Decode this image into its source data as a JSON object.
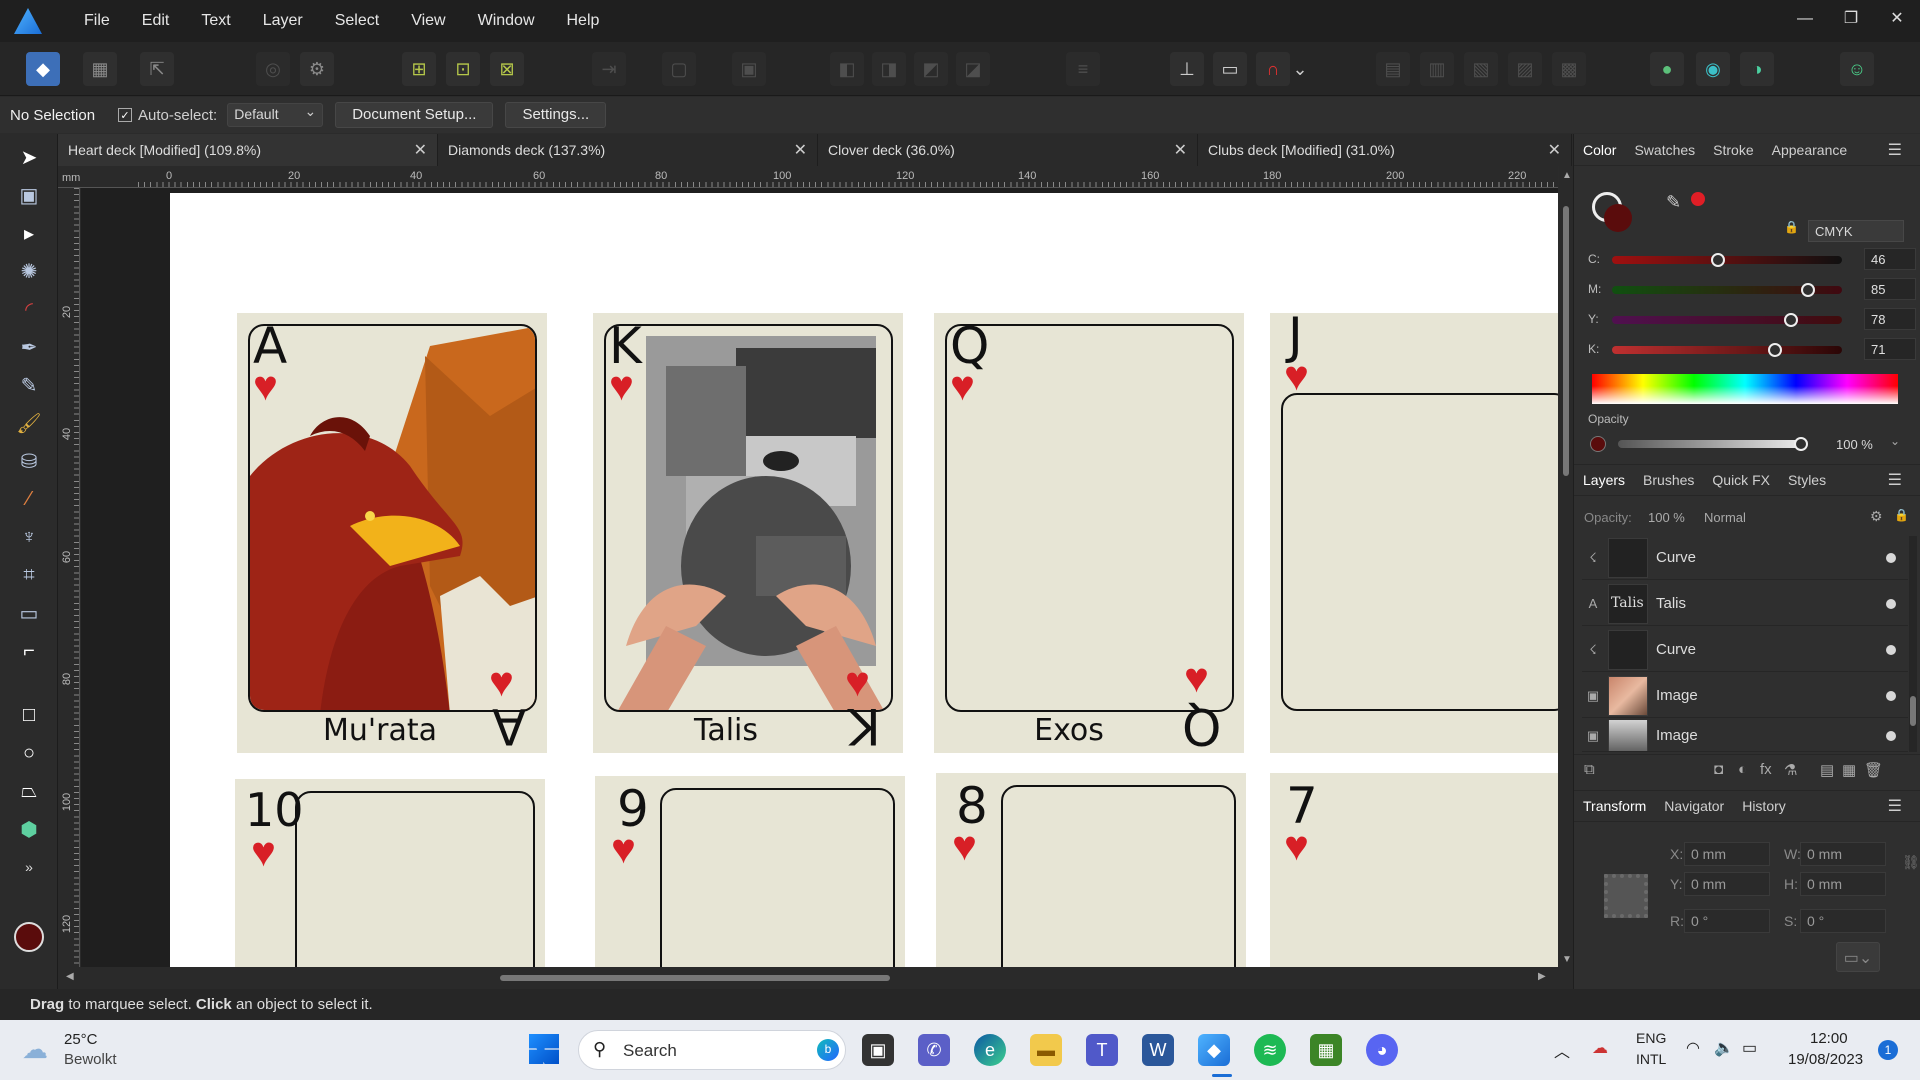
{
  "menu": [
    "File",
    "Edit",
    "Text",
    "Layer",
    "Select",
    "View",
    "Window",
    "Help"
  ],
  "window_controls": {
    "minimize": "—",
    "restore": "❐",
    "close": "✕"
  },
  "context": {
    "selection": "No Selection",
    "auto_select_label": "Auto-select:",
    "auto_select_checked": "✓",
    "auto_select_value": "Default",
    "document_setup": "Document Setup...",
    "settings": "Settings..."
  },
  "tabs": [
    {
      "label": "Heart deck [Modified] (109.8%)",
      "close": "✕"
    },
    {
      "label": "Diamonds deck (137.3%)",
      "close": "✕"
    },
    {
      "label": "Clover deck (36.0%)",
      "close": "✕"
    },
    {
      "label": "Clubs deck [Modified] (31.0%)",
      "close": "✕"
    }
  ],
  "ruler": {
    "unit": "mm",
    "h_ticks": [
      "0",
      "20",
      "40",
      "60",
      "80",
      "100",
      "120",
      "140",
      "160",
      "180",
      "200",
      "220"
    ],
    "v_ticks": [
      "20",
      "40",
      "60",
      "80",
      "100",
      "120"
    ]
  },
  "cards": {
    "top": [
      {
        "rank": "A",
        "suit": "♥",
        "name": "Mu'rata"
      },
      {
        "rank": "K",
        "suit": "♥",
        "name": "Talis"
      },
      {
        "rank": "Q",
        "suit": "♥",
        "name": "Exos"
      },
      {
        "rank": "J",
        "suit": "♥"
      }
    ],
    "bottom": [
      {
        "rank": "10",
        "suit": "♥"
      },
      {
        "rank": "9",
        "suit": "♥"
      },
      {
        "rank": "8",
        "suit": "♥"
      },
      {
        "rank": "7",
        "suit": "♥"
      }
    ]
  },
  "color_panel": {
    "tabs": [
      "Color",
      "Swatches",
      "Stroke",
      "Appearance"
    ],
    "model": "CMYK",
    "sliders": [
      {
        "label": "C:",
        "value": "46",
        "fraction": 0.46
      },
      {
        "label": "M:",
        "value": "85",
        "fraction": 0.85
      },
      {
        "label": "Y:",
        "value": "78",
        "fraction": 0.78
      },
      {
        "label": "K:",
        "value": "71",
        "fraction": 0.71
      }
    ],
    "opacity_label": "Opacity",
    "opacity_value": "100 %",
    "fill_color": "#5a0c0c",
    "accent": "#e01e26"
  },
  "layers_panel": {
    "tabs": [
      "Layers",
      "Brushes",
      "Quick FX",
      "Styles"
    ],
    "opacity_label": "Opacity:",
    "opacity_value": "100 %",
    "blend_mode": "Normal",
    "items": [
      {
        "icon": "☇",
        "thumb": "",
        "name": "Curve"
      },
      {
        "icon": "A",
        "thumb": "Talis",
        "name": "Talis"
      },
      {
        "icon": "☇",
        "thumb": "",
        "name": "Curve"
      },
      {
        "icon": "▣",
        "thumb": "",
        "name": "Image"
      },
      {
        "icon": "▣",
        "thumb": "",
        "name": "Image"
      }
    ]
  },
  "transform_panel": {
    "tabs": [
      "Transform",
      "Navigator",
      "History"
    ],
    "x_label": "X:",
    "x": "0 mm",
    "y_label": "Y:",
    "y": "0 mm",
    "w_label": "W:",
    "w": "0 mm",
    "h_label": "H:",
    "h": "0 mm",
    "r_label": "R:",
    "r": "0 °",
    "s_label": "S:",
    "s": "0 °"
  },
  "status": {
    "bold1": "Drag",
    "text1": " to marquee select. ",
    "bold2": "Click",
    "text2": " an object to select it."
  },
  "taskbar": {
    "weather_temp": "25°C",
    "weather_desc": "Bewolkt",
    "search": "Search",
    "lang1": "ENG",
    "lang2": "INTL",
    "time": "12:00",
    "date": "19/08/2023",
    "notif": "1"
  }
}
